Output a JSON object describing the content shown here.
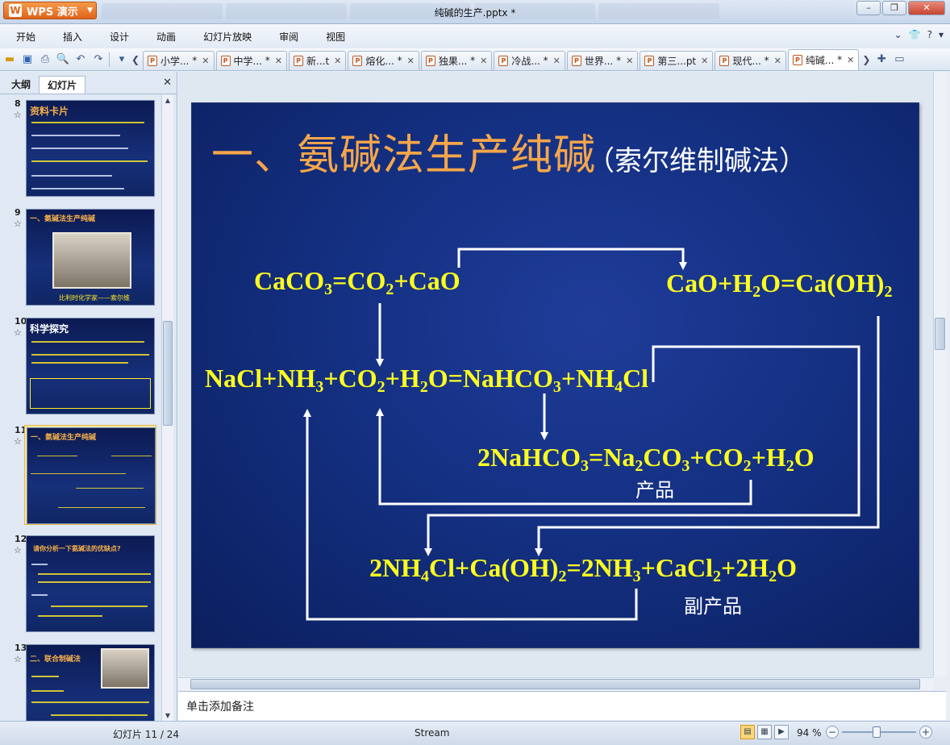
{
  "app": {
    "button_label": "WPS 演示",
    "document_title": "纯碱的生产.pptx *"
  },
  "menu": {
    "items": [
      "开始",
      "插入",
      "设计",
      "动画",
      "幻灯片放映",
      "审阅",
      "视图"
    ]
  },
  "doc_tabs": [
    {
      "label": "小学...",
      "modified": "*"
    },
    {
      "label": "中学...",
      "modified": "*"
    },
    {
      "label": "新...t",
      "modified": ""
    },
    {
      "label": "熔化...",
      "modified": "*"
    },
    {
      "label": "独果...",
      "modified": "*"
    },
    {
      "label": "冷战...",
      "modified": "*"
    },
    {
      "label": "世界...",
      "modified": "*"
    },
    {
      "label": "第三...pt",
      "modified": ""
    },
    {
      "label": "现代...",
      "modified": "*"
    },
    {
      "label": "纯碱...",
      "modified": "*"
    }
  ],
  "left_panel": {
    "tab_outline": "大纲",
    "tab_slides": "幻灯片",
    "thumbnails": [
      {
        "number": "8",
        "title": "资料卡片",
        "caption": ""
      },
      {
        "number": "9",
        "title": "一、氨碱法生产纯碱",
        "caption": "比利时化学家——索尔维"
      },
      {
        "number": "10",
        "title": "科学探究",
        "caption": ""
      },
      {
        "number": "11",
        "title": "一、氨碱法生产纯碱",
        "caption": ""
      },
      {
        "number": "12",
        "title": "请你分析一下氨碱法的优缺点?",
        "caption": ""
      },
      {
        "number": "13",
        "title": "二、联合制碱法",
        "caption": ""
      }
    ],
    "selected": 11
  },
  "slide": {
    "title": "一、氨碱法生产纯碱",
    "subtitle": "（索尔维制碱法）",
    "eq1": {
      "a": "CaCO",
      "b": "3",
      "c": "=CO",
      "d": "2",
      "e": "+CaO"
    },
    "eq2": {
      "a": "CaO+H",
      "b": "2",
      "c": "O=Ca(OH)",
      "d": "2"
    },
    "eq3": {
      "a": "NaCl+NH",
      "b": "3",
      "c": "+CO",
      "d": "2",
      "e": "+H",
      "f": "2",
      "g": "O=NaHCO",
      "h": "3",
      "i": "+NH",
      "j": "4",
      "k": "Cl"
    },
    "eq4": {
      "a": "2NaHCO",
      "b": "3",
      "c": "=Na",
      "d": "2",
      "e": "CO",
      "f": "3",
      "g": "+CO",
      "h": "2",
      "i": "+H",
      "j": "2",
      "k": "O"
    },
    "eq5": {
      "a": "2NH",
      "b": "4",
      "c": "Cl+Ca(OH)",
      "d": "2",
      "e": "=2NH",
      "f": "3",
      "g": "+CaCl",
      "h": "2",
      "i": "+2H",
      "j": "2",
      "k": "O"
    },
    "label_product": "产品",
    "label_byproduct": "副产品"
  },
  "notes_placeholder": "单击添加备注",
  "status": {
    "slide_position": "幻灯片 11 / 24",
    "theme": "Stream",
    "zoom": "94 %"
  },
  "colors": {
    "slide_bg": "#143082",
    "title_orange": "#f6a64a",
    "equation_yellow": "#ffff1e",
    "arrow_white": "#ffffff",
    "wps_orange": "#e0641a"
  }
}
